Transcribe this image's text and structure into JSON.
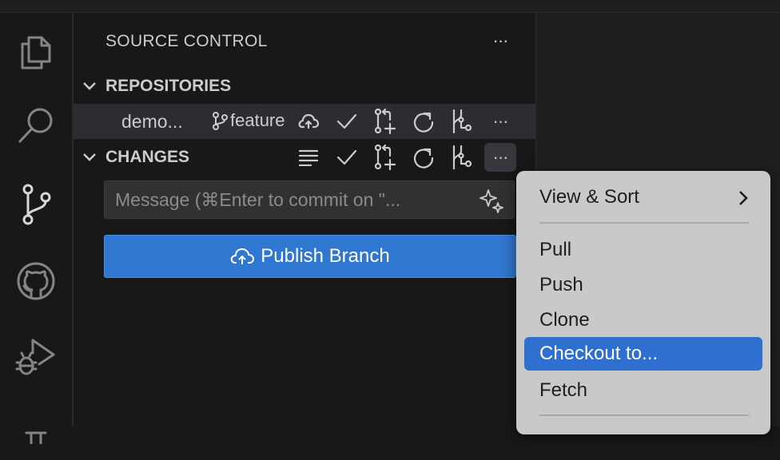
{
  "activity_bar": {
    "items": [
      {
        "icon": "explorer-icon"
      },
      {
        "icon": "search-icon"
      },
      {
        "icon": "source-control-icon",
        "active": true
      },
      {
        "icon": "github-icon"
      },
      {
        "icon": "run-debug-icon"
      },
      {
        "icon": "testing-icon"
      }
    ]
  },
  "sidebar": {
    "title": "SOURCE CONTROL",
    "more_label": "···",
    "repositories": {
      "header": "REPOSITORIES",
      "repo_name": "demo...",
      "branch": "feature"
    },
    "changes": {
      "header": "CHANGES",
      "message_placeholder": "Message (⌘Enter to commit on \"...",
      "publish_label": "Publish Branch"
    }
  },
  "context_menu": {
    "items": [
      {
        "label": "View & Sort",
        "submenu": true
      },
      {
        "label": "Pull"
      },
      {
        "label": "Push"
      },
      {
        "label": "Clone"
      },
      {
        "label": "Checkout to...",
        "selected": true
      },
      {
        "label": "Fetch"
      }
    ]
  },
  "colors": {
    "accent": "#2f77d1",
    "menu_selection": "#2f6fd0",
    "background": "#181818"
  }
}
